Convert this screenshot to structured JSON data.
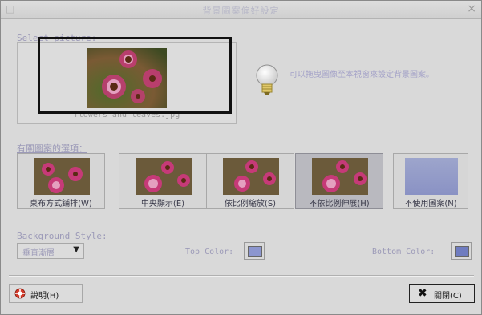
{
  "window": {
    "title": "背景圖案偏好設定",
    "menu_glyph": "□",
    "close_glyph": "×"
  },
  "picture": {
    "section_label": "Select picture:",
    "filename": "flowers_and_leaves.jpg",
    "tip": "可以拖曳圖像至本視窗來設定背景圖案。",
    "tip_icon": "lightbulb-icon"
  },
  "options": {
    "section_label": "有關圖案的選項：",
    "items": [
      {
        "label": "桌布方式鋪排(W)",
        "kind": "image"
      },
      {
        "label": "中央顯示(E)",
        "kind": "image"
      },
      {
        "label": "依比例縮放(S)",
        "kind": "image"
      },
      {
        "label": "不依比例伸展(H)",
        "kind": "image",
        "selected": true
      },
      {
        "label": "不使用圖案(N)",
        "kind": "solid"
      }
    ]
  },
  "background": {
    "style_label": "Background Style:",
    "style_value": "垂直漸層",
    "top_color_label": "Top Color:",
    "top_color": "#8c96cf",
    "bottom_color_label": "Bottom Color:",
    "bottom_color": "#6f7cc0"
  },
  "buttons": {
    "help": "說明(H)",
    "close": "關閉(C)",
    "help_icon": "lifebuoy-icon",
    "close_icon": "close-icon"
  }
}
